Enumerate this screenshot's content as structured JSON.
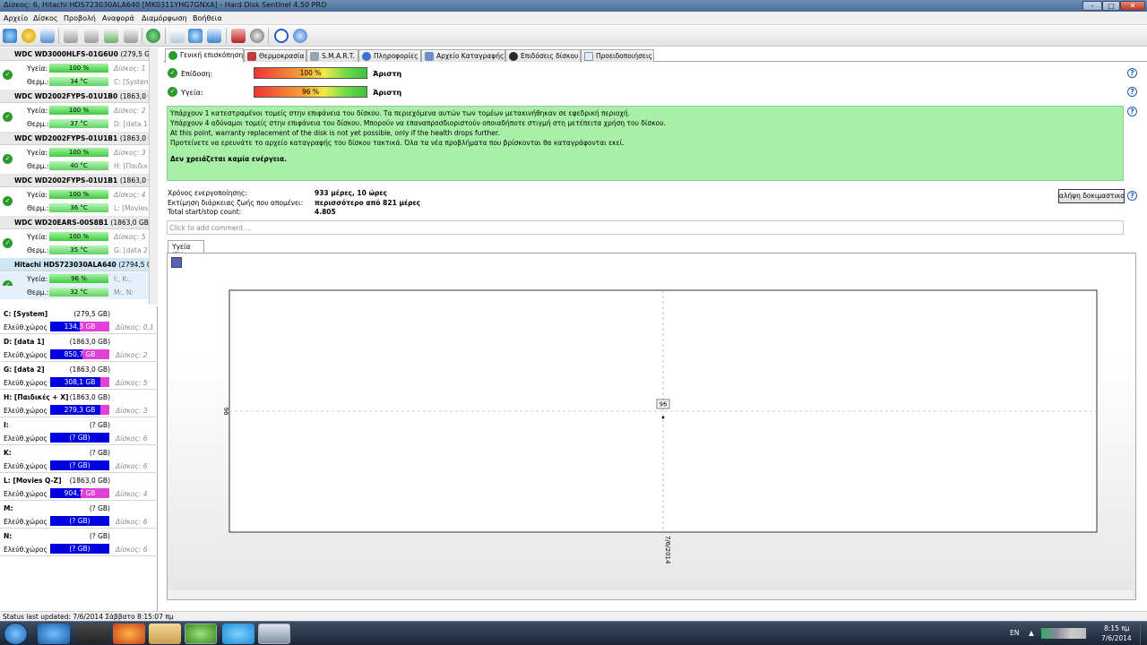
{
  "window": {
    "title": "Δίσκος: 6, Hitachi HDS723030ALA640 [MK0311YHG7GNXA]  -  Hard Disk Sentinel 4.50 PRO",
    "controls": {
      "minimize": "–",
      "maximize": "□",
      "close": "✕"
    }
  },
  "menu": [
    "Αρχείο",
    "Δίσκος",
    "Προβολή",
    "Αναφορά",
    "Διαμόρφωση",
    "Βοήθεια"
  ],
  "toolbar_icons": [
    "refresh-icon",
    "warning-icon",
    "report-icon",
    "disk-test-icon",
    "disk-test-2-icon",
    "disk-test-3-icon",
    "disk-test-4-icon",
    "web-icon",
    "export-icon",
    "refresh-2-icon",
    "send-icon",
    "performance-icon",
    "settings-icon",
    "help-icon",
    "info-icon"
  ],
  "disks": [
    {
      "name": "WDC WD3000HLFS-01G6U0",
      "size": "(279,5 GB)",
      "health_label": "Υγεία:",
      "health": "100 %",
      "health_pct": 100,
      "disk_note": "Δίσκος: 1",
      "temp_label": "Θερμ.:",
      "temp": "34 °C",
      "vols": "C: [System"
    },
    {
      "name": "WDC WD2002FYPS-01U1B0",
      "size": "(1863,0 GB)",
      "health_label": "Υγεία:",
      "health": "100 %",
      "health_pct": 100,
      "disk_note": "Δίσκος: 2",
      "temp_label": "Θερμ.:",
      "temp": "37 °C",
      "vols": "D: [data 1]"
    },
    {
      "name": "WDC WD2002FYPS-01U1B1",
      "size": "(1863,0 GB)",
      "health_label": "Υγεία:",
      "health": "100 %",
      "health_pct": 100,
      "disk_note": "Δίσκος: 3",
      "temp_label": "Θερμ.:",
      "temp": "40 °C",
      "vols": "H: [Παιδικ"
    },
    {
      "name": "WDC WD2002FYPS-01U1B1",
      "size": "(1863,0 GB)",
      "health_label": "Υγεία:",
      "health": "100 %",
      "health_pct": 100,
      "disk_note": "Δίσκος: 4",
      "temp_label": "Θερμ.:",
      "temp": "36 °C",
      "vols": "L: [Movies"
    },
    {
      "name": "WDC WD20EARS-00S8B1",
      "size": "(1863,0 GB)",
      "health_label": "Υγεία:",
      "health": "100 %",
      "health_pct": 100,
      "disk_note": "Δίσκος: 5",
      "temp_label": "Θερμ.:",
      "temp": "35 °C",
      "vols": "G: [data 2]"
    },
    {
      "name": "Hitachi HDS723030ALA640",
      "size": "(2794,5 GB)",
      "health_label": "Υγεία:",
      "health": "96 %",
      "health_pct": 96,
      "disk_note": "I:, K:,",
      "temp_label": "Θερμ.:",
      "temp": "32 °C",
      "vols": "M:, N:",
      "selected": true
    }
  ],
  "volumes": [
    {
      "name": "C: [System]",
      "size": "(279,5 GB)",
      "free_label": "Ελεύθ.χώρος",
      "free": "134,3 GB",
      "used_pct": 50,
      "disk": "Δίσκος: 0,1"
    },
    {
      "name": "D: [data 1]",
      "size": "(1863,0 GB)",
      "free_label": "Ελεύθ.χώρος",
      "free": "850,7 GB",
      "used_pct": 45,
      "disk": "Δίσκος: 2"
    },
    {
      "name": "G: [data 2]",
      "size": "(1863,0 GB)",
      "free_label": "Ελεύθ.χώρος",
      "free": "308,1 GB",
      "used_pct": 15,
      "disk": "Δίσκος: 5"
    },
    {
      "name": "H: [Παιδικές + Χ]",
      "size": "(1863,0 GB)",
      "free_label": "Ελεύθ.χώρος",
      "free": "279,3 GB",
      "used_pct": 15,
      "disk": "Δίσκος: 3"
    },
    {
      "name": "I:",
      "size": "(? GB)",
      "free_label": "Ελεύθ.χώρος",
      "free": "(? GB)",
      "used_pct": 0,
      "disk": "Δίσκος: 6"
    },
    {
      "name": "K:",
      "size": "(? GB)",
      "free_label": "Ελεύθ.χώρος",
      "free": "(? GB)",
      "used_pct": 0,
      "disk": "Δίσκος: 6"
    },
    {
      "name": "L: [Movies Q-Z]",
      "size": "(1863,0 GB)",
      "free_label": "Ελεύθ.χώρος",
      "free": "904,7 GB",
      "used_pct": 48,
      "disk": "Δίσκος: 4"
    },
    {
      "name": "M:",
      "size": "(? GB)",
      "free_label": "Ελεύθ.χώρος",
      "free": "(? GB)",
      "used_pct": 0,
      "disk": "Δίσκος: 6"
    },
    {
      "name": "N:",
      "size": "(? GB)",
      "free_label": "Ελεύθ.χώρος",
      "free": "(? GB)",
      "used_pct": 0,
      "disk": "Δίσκος: 6"
    }
  ],
  "tabs": [
    "Γενική επισκόπηση",
    "Θερμοκρασία",
    "S.M.A.R.T.",
    "Πληροφορίες",
    "Αρχείο Καταγραφής",
    "Επιδόσεις δίσκου",
    "Προειδοποιήσεις"
  ],
  "overview": {
    "performance_label": "Επίδοση:",
    "performance_value": "100 %",
    "performance_pct": 100,
    "performance_rating": "Άριστη",
    "health_label": "Υγεία:",
    "health_value": "96 %",
    "health_pct": 96,
    "health_rating": "Άριστη",
    "info_lines": [
      "Υπάρχουν 1 κατεστραμένοι τομείς στην επιφάνεια του δίσκου. Τα περιεχόμενα αυτών των τομέων μετακινήθηκαν σε εφεδρική περιοχή.",
      "Υπάρχουν 4 αδύναμοι τομείς στην επιφάνεια του δίσκου. Μπορούν να επαναπροσδιοριστούν οποιαδήποτε στιγμή στη μετέπειτα χρήση του δίσκου.",
      "At this point, warranty replacement of the disk is not yet possible, only if the health drops further.",
      "Προτείνετε να ερευνάτε το αρχείο καταγραφής του δίσκου τακτικά. Όλα τα νέα προβλήματα που βρίσκονται θα καταγράφονται εκεί."
    ],
    "info_action": "Δεν χρειάζεται καμία ενέργεια.",
    "power_on_label": "Χρόνος ενεργοποίησης:",
    "power_on_value": "933 μέρες, 10 ώρες",
    "lifetime_label": "Εκτίμηση διάρκειας ζωής που απομένει:",
    "lifetime_value": "περισσότερο από 821 μέρες",
    "startstop_label": "Total start/stop count:",
    "startstop_value": "4.805",
    "comment_placeholder": "Click to add comment ...",
    "button_label": "αλήψη δοκιμαστικο"
  },
  "chart_tab": "Υγεία (%)",
  "chart_data": {
    "type": "line",
    "x": [
      "7/6/2014"
    ],
    "series": [
      {
        "values": [
          96
        ]
      }
    ],
    "data_labels": [
      "96"
    ],
    "ytick_labels": [
      "96"
    ],
    "xtick_labels": [
      "7/6/2014"
    ],
    "grid": true
  },
  "statusbar": "Status last updated: 7/6/2014 Σάββατο 8:15:07 πμ",
  "taskbar": {
    "apps": [
      "ie-icon",
      "explorer-icon",
      "firefox-icon",
      "folder-icon",
      "utorrent-icon",
      "skype-icon",
      "hdsentinel-icon"
    ],
    "lang": "EN",
    "time": "8:15 πμ",
    "date": "7/6/2014"
  }
}
